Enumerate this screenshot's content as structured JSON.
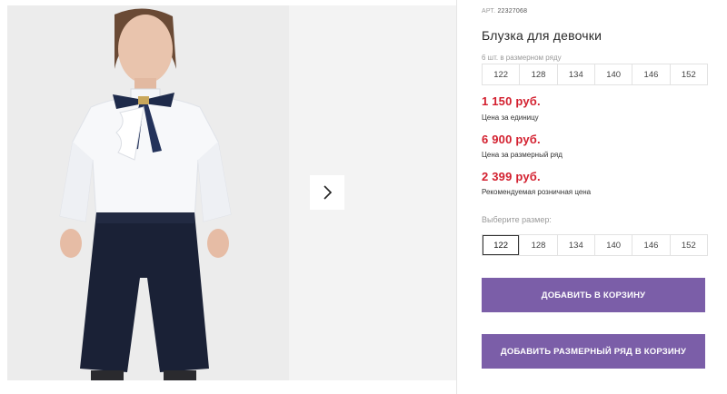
{
  "product": {
    "art_label": "АРТ.",
    "art_number": "22327068",
    "title": "Блузка для девочки",
    "pack_note": "6 шт. в размерном ряду"
  },
  "pack_sizes": [
    "122",
    "128",
    "134",
    "140",
    "146",
    "152"
  ],
  "prices": [
    {
      "value": "1 150 руб.",
      "note": "Цена за единицу"
    },
    {
      "value": "6 900 руб.",
      "note": "Цена за размерный ряд"
    },
    {
      "value": "2 399 руб.",
      "note": "Рекомендуемая розничная цена"
    }
  ],
  "size_selector": {
    "label": "Выберите размер:",
    "options": [
      "122",
      "128",
      "134",
      "140",
      "146",
      "152"
    ],
    "selected": "122"
  },
  "buttons": {
    "add_to_cart": "ДОБАВИТЬ В КОРЗИНУ",
    "add_pack_to_cart": "ДОБАВИТЬ РАЗМЕРНЫЙ РЯД В КОРЗИНУ"
  },
  "icons": {
    "next": "chevron-right-icon"
  },
  "colors": {
    "price": "#d3202f",
    "button": "#7b5ea8"
  }
}
